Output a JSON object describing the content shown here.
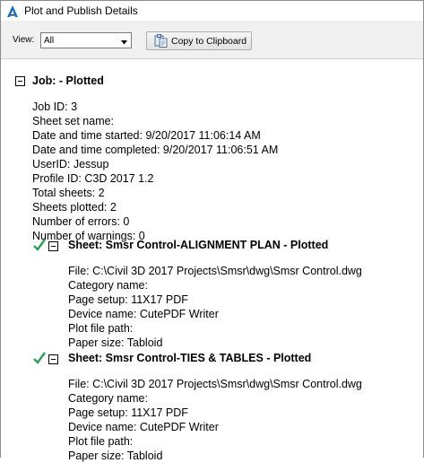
{
  "window": {
    "title": "Plot and Publish Details",
    "app_icon": "autocad-a-icon"
  },
  "toolbar": {
    "view_label": "View:",
    "view_selected": "All",
    "copy_label": "Copy to Clipboard"
  },
  "job": {
    "heading": "Job: - Plotted",
    "lines": [
      "Job ID: 3",
      "Sheet set name:",
      "Date and time started: 9/20/2017 11:06:14 AM",
      "Date and time completed: 9/20/2017 11:06:51 AM",
      "UserID: Jessup",
      "Profile ID: C3D 2017 1.2",
      "Total sheets: 2",
      "Sheets plotted: 2",
      "Number of errors: 0",
      "Number of warnings: 0"
    ]
  },
  "sheets": [
    {
      "heading": "Sheet: Smsr Control-ALIGNMENT PLAN - Plotted",
      "lines": [
        "File: C:\\Civil 3D 2017 Projects\\Smsr\\dwg\\Smsr Control.dwg",
        "Category name:",
        "Page setup: 11X17 PDF",
        "Device name: CutePDF Writer",
        "Plot file path:",
        "Paper size: Tabloid"
      ]
    },
    {
      "heading": "Sheet: Smsr Control-TIES & TABLES - Plotted",
      "lines": [
        "File: C:\\Civil 3D 2017 Projects\\Smsr\\dwg\\Smsr Control.dwg",
        "Category name:",
        "Page setup: 11X17 PDF",
        "Device name: CutePDF Writer",
        "Plot file path:",
        "Paper size: Tabloid"
      ]
    }
  ],
  "colors": {
    "check": "#2e9b5a",
    "app_icon": "#1a6fb5"
  }
}
